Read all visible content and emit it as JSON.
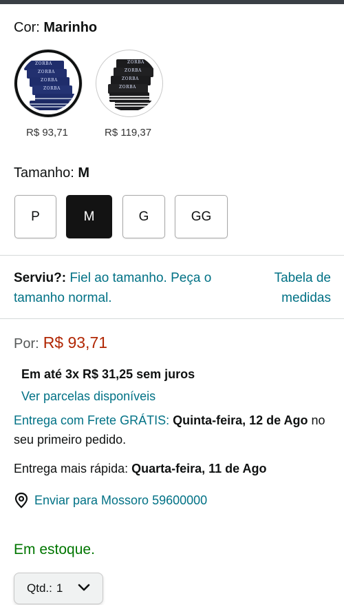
{
  "color": {
    "label": "Cor:",
    "selected": "Marinho",
    "swatches": [
      {
        "price": "R$ 93,71",
        "brand": "ZORBA",
        "fabric": "#1f2d6b",
        "selected": true
      },
      {
        "price": "R$ 119,37",
        "brand": "ZORBA",
        "fabric": "#1b1b1d",
        "selected": false
      }
    ]
  },
  "size": {
    "label": "Tamanho:",
    "selected": "M",
    "options": [
      "P",
      "M",
      "G",
      "GG"
    ]
  },
  "fit": {
    "label": "Serviu?:",
    "text": "Fiel ao tamanho. Peça o tamanho normal.",
    "chart_link": "Tabela de medidas"
  },
  "pricing": {
    "por_label": "Por:",
    "price": "R$ 93,71",
    "installments": "Em até 3x R$ 31,25 sem juros",
    "installments_link": "Ver parcelas disponíveis"
  },
  "delivery": {
    "free_label": "Entrega com Frete GRÁTIS:",
    "free_date": "Quinta-feira, 12 de Ago",
    "free_suffix": "no seu primeiro pedido.",
    "fast_label": "Entrega mais rápida:",
    "fast_date": "Quarta-feira, 11 de Ago",
    "ship_to": "Enviar para Mossoro 59600000",
    "location_icon": "location-pin-icon"
  },
  "stock": "Em estoque.",
  "quantity": {
    "label": "Qtd.:",
    "value": "1",
    "chevron_icon": "chevron-down-icon"
  },
  "colors": {
    "link": "#007185",
    "price": "#b12704",
    "in_stock": "#007600",
    "selected_size_bg": "#131313"
  }
}
